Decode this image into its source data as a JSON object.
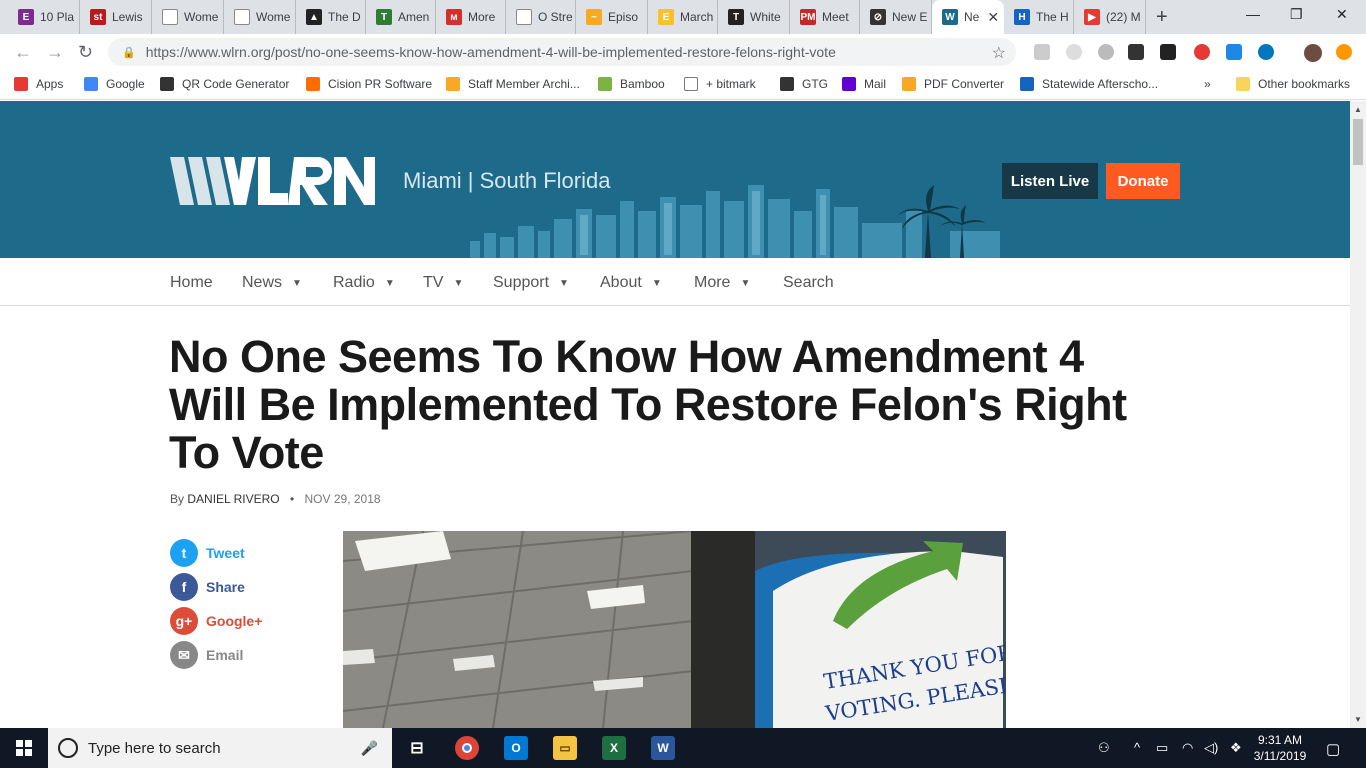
{
  "tabs": [
    {
      "label": "10 Pla",
      "fav": "E",
      "color": "#7b2d8e"
    },
    {
      "label": "Lewis",
      "fav": "st",
      "color": "#b71c1c"
    },
    {
      "label": "Wome",
      "fav": "",
      "color": "#ffffff"
    },
    {
      "label": "Wome",
      "fav": "",
      "color": "#ffffff"
    },
    {
      "label": "The D",
      "fav": "▲",
      "color": "#222222"
    },
    {
      "label": "Amen",
      "fav": "T",
      "color": "#2e7d32"
    },
    {
      "label": "More",
      "fav": "ᴍ",
      "color": "#d32f2f"
    },
    {
      "label": "O Stre",
      "fav": "",
      "color": "#ffffff"
    },
    {
      "label": "Episo",
      "fav": "~",
      "color": "#f9a825"
    },
    {
      "label": "March",
      "fav": "E",
      "color": "#fbc02d"
    },
    {
      "label": "White",
      "fav": "T",
      "color": "#222222"
    },
    {
      "label": "Meet",
      "fav": "PM",
      "color": "#c62828"
    },
    {
      "label": "New E",
      "fav": "⊘",
      "color": "#333333"
    },
    {
      "label": "Ne",
      "fav": "W",
      "color": "#1e6a8a",
      "active": true
    },
    {
      "label": "The H",
      "fav": "H",
      "color": "#1565c0"
    },
    {
      "label": "(22) M",
      "fav": "▶",
      "color": "#e53935"
    }
  ],
  "address": {
    "host": "https://www.wlrn.org",
    "path": "/post/no-one-seems-know-how-amendment-4-will-be-implemented-restore-felons-right-vote"
  },
  "bookmarks": [
    {
      "label": "Apps",
      "icon": "apps-icon",
      "color": "#e53935"
    },
    {
      "label": "Google",
      "icon": "google-icon",
      "color": "#4285f4"
    },
    {
      "label": "QR Code Generator",
      "icon": "qr-icon",
      "color": "#333333"
    },
    {
      "label": "Cision PR Software",
      "icon": "cision-icon",
      "color": "#ff6d00"
    },
    {
      "label": "Staff Member Archi...",
      "icon": "staff-icon",
      "color": "#f9a825"
    },
    {
      "label": "Bamboo",
      "icon": "bamboo-icon",
      "color": "#7cb342"
    },
    {
      "label": "+ bitmark",
      "icon": "page-icon",
      "color": "#ffffff"
    },
    {
      "label": "GTG",
      "icon": "gtg-icon",
      "color": "#333333"
    },
    {
      "label": "Mail",
      "icon": "yahoo-icon",
      "color": "#6001d2"
    },
    {
      "label": "PDF Converter",
      "icon": "pdf-icon",
      "color": "#f9a825"
    },
    {
      "label": "Statewide Afterscho...",
      "icon": "san-icon",
      "color": "#1565c0"
    }
  ],
  "other_bookmarks": "Other bookmarks",
  "overflow": "»",
  "site": {
    "logo_text": "WLRN",
    "tagline": "Miami | South Florida",
    "listen_live": "Listen Live",
    "donate": "Donate"
  },
  "nav": [
    {
      "label": "Home",
      "dropdown": false
    },
    {
      "label": "News",
      "dropdown": true
    },
    {
      "label": "Radio",
      "dropdown": true
    },
    {
      "label": "TV",
      "dropdown": true
    },
    {
      "label": "Support",
      "dropdown": true
    },
    {
      "label": "About",
      "dropdown": true
    },
    {
      "label": "More",
      "dropdown": true
    },
    {
      "label": "Search",
      "dropdown": false
    }
  ],
  "article": {
    "headline_lines": [
      "No One Seems To Know How Amendment 4",
      "Will Be Implemented To Restore Felon's Right",
      "To Vote"
    ],
    "by": "By",
    "author": "DANIEL RIVERO",
    "date": "NOV 29, 2018",
    "photo_sign_line1": "THANK YOU FOR",
    "photo_sign_line2": "VOTING. PLEASE"
  },
  "share": [
    {
      "label": "Tweet",
      "icon": "twitter-icon",
      "color": "#1da1f2"
    },
    {
      "label": "Share",
      "icon": "facebook-icon",
      "color": "#3b5998"
    },
    {
      "label": "Google+",
      "icon": "google-plus-icon",
      "color": "#dd4b39"
    },
    {
      "label": "Email",
      "icon": "email-icon",
      "color": "#888888"
    }
  ],
  "taskbar": {
    "search_placeholder": "Type here to search",
    "time": "9:31 AM",
    "date": "3/11/2019"
  }
}
